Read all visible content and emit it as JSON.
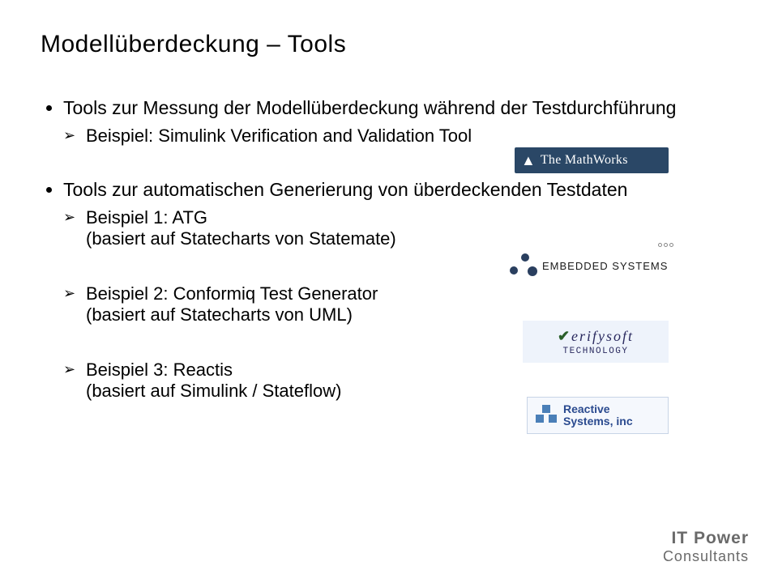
{
  "title": "Modellüberdeckung – Tools",
  "b1": "Tools zur Messung der Modellüberdeckung während der Testdurchführung",
  "b1s1": "Beispiel: Simulink Verification and Validation Tool",
  "b2": "Tools zur automatischen Generierung von überdeckenden Testdaten",
  "b2s1a": "Beispiel 1: ATG",
  "b2s1b": "(basiert auf Statecharts von Statemate)",
  "b2s2a": "Beispiel 2: Conformiq Test Generator",
  "b2s2b": "(basiert auf Statecharts von UML)",
  "b2s3a": "Beispiel 3: Reactis",
  "b2s3b": "(basiert auf Simulink / Stateflow)",
  "logos": {
    "mathworks": "The MathWorks",
    "embedded": "EMBEDDED SYSTEMS",
    "verifysoft1": "erifysoft",
    "verifysoft2": "TECHNOLOGY",
    "reactive1": "Reactive",
    "reactive2": "Systems, inc"
  },
  "footer": {
    "l1": "IT Power",
    "l2": "Consultants"
  }
}
